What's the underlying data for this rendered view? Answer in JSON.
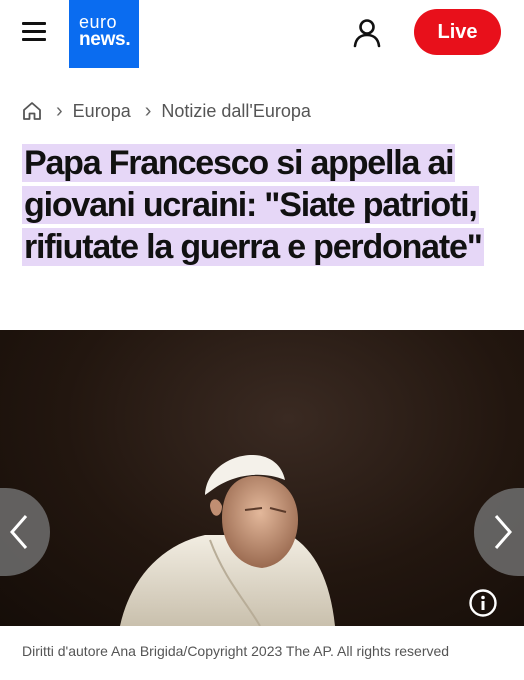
{
  "header": {
    "menu_icon": "hamburger-menu-icon",
    "logo_line1": "euro",
    "logo_line2": "news.",
    "account_icon": "user-icon",
    "live_label": "Live",
    "colors": {
      "logo_bg": "#0a6cf0",
      "live_bg": "#e8101b"
    }
  },
  "breadcrumb": {
    "home_icon": "home-icon",
    "items": [
      "Europa",
      "Notizie dall'Europa"
    ]
  },
  "article": {
    "title": "Papa Francesco si appella ai giovani ucraini: \"Siate patrioti, rifiutate la guerra e perdonate\"",
    "title_highlight_color": "#e6d7f7"
  },
  "gallery": {
    "prev_icon": "chevron-left-icon",
    "next_icon": "chevron-right-icon",
    "info_icon": "info-icon",
    "caption": "Diritti d'autore Ana Brigida/Copyright 2023 The AP. All rights reserved"
  }
}
